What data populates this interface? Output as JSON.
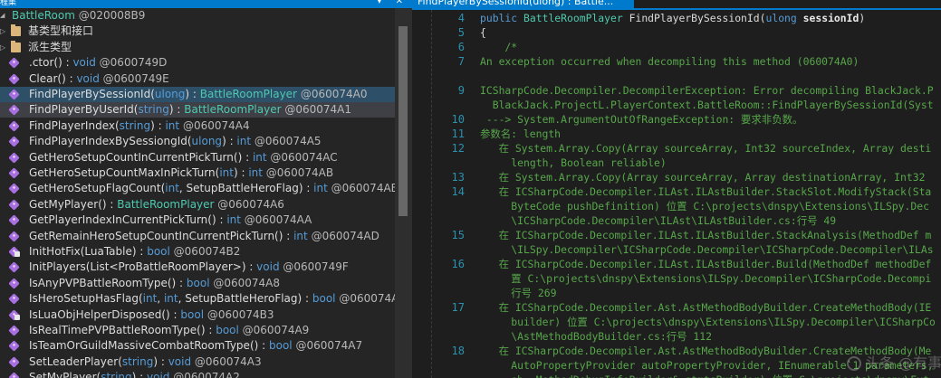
{
  "left_panel": {
    "title_fragment": "程集",
    "window_buttons": "▾ ✕",
    "tree": [
      {
        "kind": "class",
        "indent": 0,
        "expanded": true,
        "name": "BattleRoom",
        "suffix": " @020008B9",
        "selected": false
      },
      {
        "kind": "folder",
        "indent": 1,
        "expanded": false,
        "name": "基类型和接口",
        "suffix": "",
        "selected": false
      },
      {
        "kind": "folder",
        "indent": 1,
        "expanded": false,
        "name": "派生类型",
        "suffix": "",
        "selected": false
      },
      {
        "kind": "method",
        "indent": 1,
        "name": ".ctor",
        "params": "()",
        "ret": "void",
        "token": " @0600749D",
        "selected": false
      },
      {
        "kind": "method",
        "indent": 1,
        "name": "Clear",
        "params": "()",
        "ret": "void",
        "token": " @0600749E",
        "selected": false
      },
      {
        "kind": "method",
        "indent": 1,
        "name": "FindPlayerBySessionId",
        "params": "(ulong)",
        "ret": "BattleRoomPlayer",
        "token": " @060074A0",
        "selected": "blue"
      },
      {
        "kind": "method",
        "indent": 1,
        "name": "FindPlayerByUserId",
        "params": "(string)",
        "ret": "BattleRoomPlayer",
        "token": " @060074A1",
        "selected": "grey"
      },
      {
        "kind": "method",
        "indent": 1,
        "name": "FindPlayerIndex",
        "params": "(string)",
        "ret": "int",
        "token": " @060074A4",
        "selected": false
      },
      {
        "kind": "method",
        "indent": 1,
        "name": "FindPlayerIndexBySessiongId",
        "params": "(ulong)",
        "ret": "int",
        "token": " @060074A5",
        "selected": false
      },
      {
        "kind": "method",
        "indent": 1,
        "name": "GetHeroSetupCountInCurrentPickTurn",
        "params": "()",
        "ret": "int",
        "token": " @060074AC",
        "selected": false
      },
      {
        "kind": "method",
        "indent": 1,
        "name": "GetHeroSetupCountMaxInPickTurn",
        "params": "(int)",
        "ret": "int",
        "token": " @060074AB",
        "selected": false
      },
      {
        "kind": "method",
        "indent": 1,
        "name": "GetHeroSetupFlagCount",
        "params": "(int, SetupBattleHeroFlag)",
        "ret": "int",
        "token": " @060074AE",
        "selected": false
      },
      {
        "kind": "method",
        "indent": 1,
        "name": "GetMyPlayer",
        "params": "()",
        "ret": "BattleRoomPlayer",
        "token": " @060074A6",
        "selected": false
      },
      {
        "kind": "method",
        "indent": 1,
        "name": "GetPlayerIndexInCurrentPickTurn",
        "params": "()",
        "ret": "int",
        "token": " @060074AA",
        "selected": false
      },
      {
        "kind": "method",
        "indent": 1,
        "name": "GetRemainHeroSetupCountInCurrentPickTurn",
        "params": "()",
        "ret": "int",
        "token": " @060074AD",
        "selected": false
      },
      {
        "kind": "method",
        "indent": 1,
        "name": "InitHotFix",
        "params": "(LuaTable)",
        "ret": "bool",
        "token": " @060074B2",
        "selected": false,
        "locked": true
      },
      {
        "kind": "method",
        "indent": 1,
        "name": "InitPlayers",
        "params": "(List<ProBattleRoomPlayer>)",
        "ret": "void",
        "token": " @0600749F",
        "selected": false
      },
      {
        "kind": "method",
        "indent": 1,
        "name": "IsAnyPVPBattleRoomType",
        "params": "()",
        "ret": "bool",
        "token": " @060074A8",
        "selected": false
      },
      {
        "kind": "method",
        "indent": 1,
        "name": "IsHeroSetupHasFlag",
        "params": "(int, int, SetupBattleHeroFlag)",
        "ret": "bool",
        "token": " @060074AF",
        "selected": false
      },
      {
        "kind": "method",
        "indent": 1,
        "name": "IsLuaObjHelperDisposed",
        "params": "()",
        "ret": "bool",
        "token": " @060074B3",
        "selected": false,
        "locked": true
      },
      {
        "kind": "method",
        "indent": 1,
        "name": "IsRealTimePVPBattleRoomType",
        "params": "()",
        "ret": "bool",
        "token": " @060074A9",
        "selected": false
      },
      {
        "kind": "method",
        "indent": 1,
        "name": "IsTeamOrGuildMassiveCombatRoomType",
        "params": "()",
        "ret": "bool",
        "token": " @060074A7",
        "selected": false
      },
      {
        "kind": "method",
        "indent": 1,
        "name": "SetLeaderPlayer",
        "params": "(string)",
        "ret": "void",
        "token": " @060074A3",
        "selected": false
      },
      {
        "kind": "method",
        "indent": 1,
        "name": "SetMyPlayer",
        "params": "(string)",
        "ret": "void",
        "token": " @060074A2",
        "selected": false
      }
    ]
  },
  "editor": {
    "tab_title": "FindPlayerBySessionId(ulong) : Battle...",
    "tab_close": "✕",
    "lines": [
      {
        "num": "4",
        "kind": "sig",
        "parts": [
          [
            "kw",
            "public "
          ],
          [
            "ty",
            "BattleRoomPlayer "
          ],
          [
            "",
            "FindPlayerBySessionId("
          ],
          [
            "kw",
            "ulong "
          ],
          [
            "bold",
            "sessionId"
          ],
          [
            "",
            ")"
          ]
        ]
      },
      {
        "num": "5",
        "kind": "code",
        "text": "{"
      },
      {
        "num": "6",
        "kind": "cm",
        "text": "    /*"
      },
      {
        "num": "7",
        "kind": "cm",
        "text": "An exception occurred when decompiling this method (060074A0)"
      },
      {
        "num": "",
        "kind": "cm",
        "text": ""
      },
      {
        "num": "9",
        "kind": "cm",
        "text": "ICSharpCode.Decompiler.DecompilerException: Error decompiling BlackJack.P"
      },
      {
        "num": "",
        "kind": "cm",
        "text": "  BlackJack.ProjectL.PlayerContext.BattleRoom::FindPlayerBySessionId(Syst"
      },
      {
        "num": "10",
        "kind": "cm",
        "text": " ---> System.ArgumentOutOfRangeException: 要求非负数。"
      },
      {
        "num": "11",
        "kind": "cm",
        "text": "参数名: length"
      },
      {
        "num": "12",
        "kind": "cm",
        "text": "   在 System.Array.Copy(Array sourceArray, Int32 sourceIndex, Array desti"
      },
      {
        "num": "",
        "kind": "cm",
        "text": "     length, Boolean reliable)"
      },
      {
        "num": "13",
        "kind": "cm",
        "text": "   在 System.Array.Copy(Array sourceArray, Array destinationArray, Int32 "
      },
      {
        "num": "14",
        "kind": "cm",
        "text": "   在 ICSharpCode.Decompiler.ILAst.ILAstBuilder.StackSlot.ModifyStack(Sta"
      },
      {
        "num": "",
        "kind": "cm",
        "text": "     ByteCode pushDefinition) 位置 C:\\projects\\dnspy\\Extensions\\ILSpy.Dec"
      },
      {
        "num": "",
        "kind": "cm",
        "text": "     \\ICSharpCode.Decompiler\\ILAst\\ILAstBuilder.cs:行号 49"
      },
      {
        "num": "15",
        "kind": "cm",
        "text": "   在 ICSharpCode.Decompiler.ILAst.ILAstBuilder.StackAnalysis(MethodDef m"
      },
      {
        "num": "",
        "kind": "cm",
        "text": "     \\ILSpy.Decompiler\\ICSharpCode.Decompiler\\ICSharpCode.Decompiler\\ILAs"
      },
      {
        "num": "16",
        "kind": "cm",
        "text": "   在 ICSharpCode.Decompiler.ILAst.ILAstBuilder.Build(MethodDef methodDef"
      },
      {
        "num": "",
        "kind": "cm",
        "text": "     置 C:\\projects\\dnspy\\Extensions\\ILSpy.Decompiler\\ICSharpCode.Decompi"
      },
      {
        "num": "",
        "kind": "cm",
        "text": "     行号 269"
      },
      {
        "num": "17",
        "kind": "cm",
        "text": "   在 ICSharpCode.Decompiler.Ast.AstMethodBodyBuilder.CreateMethodBody(IE"
      },
      {
        "num": "",
        "kind": "cm",
        "text": "     builder) 位置 C:\\projects\\dnspy\\Extensions\\ILSpy.Decompiler\\ICSharpCo"
      },
      {
        "num": "",
        "kind": "cm",
        "text": "     \\AstMethodBodyBuilder.cs:行号 112"
      },
      {
        "num": "18",
        "kind": "cm",
        "text": "   在 ICSharpCode.Decompiler.Ast.AstMethodBodyBuilder.CreateMethodBody(Me"
      },
      {
        "num": "",
        "kind": "cm",
        "text": "     AutoPropertyProvider autoPropertyProvider, IEnumerable`1 parameters,"
      },
      {
        "num": "",
        "kind": "cm",
        "text": "     sb, MethodDebugInfoBuilder& stmtsBuilder) 位置 C:\\projects\\dnspy\\Ext"
      }
    ]
  },
  "watermark": "头条 @有事"
}
